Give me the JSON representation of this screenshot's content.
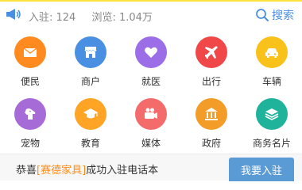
{
  "topbar": {
    "settled_label": "入驻: 124",
    "views_label": "浏览: 1.04万",
    "search_label": "搜索"
  },
  "categories": [
    {
      "label": "便民",
      "icon": "envelope-icon",
      "color": "#ff8a1f"
    },
    {
      "label": "商户",
      "icon": "store-icon",
      "color": "#4a90e2"
    },
    {
      "label": "就医",
      "icon": "heart-icon",
      "color": "#9b6ee8"
    },
    {
      "label": "出行",
      "icon": "airplane-icon",
      "color": "#f04848"
    },
    {
      "label": "车辆",
      "icon": "car-icon",
      "color": "#f8c21b"
    },
    {
      "label": "宠物",
      "icon": "dog-icon",
      "color": "#a76bd8"
    },
    {
      "label": "教育",
      "icon": "graduation-cap-icon",
      "color": "#ffa425"
    },
    {
      "label": "媒体",
      "icon": "video-camera-icon",
      "color": "#f46b6b"
    },
    {
      "label": "政府",
      "icon": "government-building-icon",
      "color": "#f39c27"
    },
    {
      "label": "商务名片",
      "icon": "layers-icon",
      "color": "#1fb39b"
    }
  ],
  "banner": {
    "prefix": "恭喜",
    "highlight": "[赛德家具]",
    "suffix": "成功入驻电话本",
    "join_label": "我要入驻"
  },
  "colors": {
    "accent_yellow": "#ffe23b",
    "search_blue": "#4a90e2",
    "join_button": "#5b9bd5",
    "highlight_orange": "#ff8c1a"
  }
}
